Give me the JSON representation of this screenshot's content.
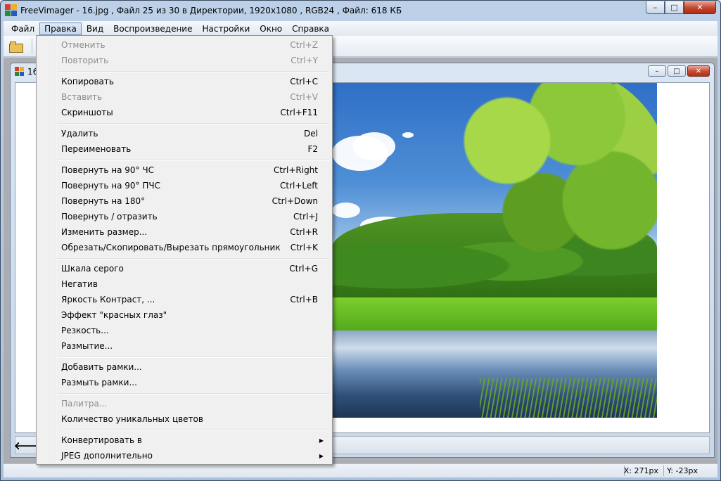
{
  "window": {
    "title": "FreeVimager - 16.jpg , Файл  25 из 30 в Директории, 1920x1080 , RGB24 , Файл: 618 КБ",
    "minimize": "–",
    "maximize": "□",
    "close": "✕"
  },
  "menubar": [
    "Файл",
    "Правка",
    "Вид",
    "Воспроизведение",
    "Настройки",
    "Окно",
    "Справка"
  ],
  "menubar_active": "Правка",
  "child": {
    "title": "16",
    "minimize": "–",
    "maximize": "□",
    "close": "✕",
    "back_glyph": "🡐"
  },
  "edit_menu": {
    "items": [
      {
        "label": "Отменить",
        "shortcut": "Ctrl+Z",
        "disabled": true
      },
      {
        "label": "Повторить",
        "shortcut": "Ctrl+Y",
        "disabled": true
      },
      {
        "label": "Копировать",
        "shortcut": "Ctrl+C",
        "disabled": false
      },
      {
        "label": "Вставить",
        "shortcut": "Ctrl+V",
        "disabled": true
      },
      {
        "label": "Скриншоты",
        "shortcut": "Ctrl+F11",
        "disabled": false
      },
      {
        "label": "Удалить",
        "shortcut": "Del",
        "disabled": false
      },
      {
        "label": "Переименовать",
        "shortcut": "F2",
        "disabled": false
      },
      {
        "label": "Повернуть на  90° ЧС",
        "shortcut": "Ctrl+Right",
        "disabled": false
      },
      {
        "label": "Повернуть на  90° ПЧС",
        "shortcut": "Ctrl+Left",
        "disabled": false
      },
      {
        "label": "Повернуть на 180°",
        "shortcut": "Ctrl+Down",
        "disabled": false
      },
      {
        "label": "Повернуть / отразить",
        "shortcut": "Ctrl+J",
        "disabled": false
      },
      {
        "label": "Изменить размер...",
        "shortcut": "Ctrl+R",
        "disabled": false
      },
      {
        "label": "Обрезать/Скопировать/Вырезать прямоугольник",
        "shortcut": "Ctrl+K",
        "disabled": false
      },
      {
        "label": "Шкала серого",
        "shortcut": "Ctrl+G",
        "disabled": false
      },
      {
        "label": "Негатив",
        "shortcut": "",
        "disabled": false
      },
      {
        "label": "Яркость Контраст, ...",
        "shortcut": "Ctrl+B",
        "disabled": false
      },
      {
        "label": "Эффект \"красных глаз\"",
        "shortcut": "",
        "disabled": false
      },
      {
        "label": "Резкость...",
        "shortcut": "",
        "disabled": false
      },
      {
        "label": "Размытие...",
        "shortcut": "",
        "disabled": false
      },
      {
        "label": "Добавить рамки...",
        "shortcut": "",
        "disabled": false
      },
      {
        "label": "Размыть рамки...",
        "shortcut": "",
        "disabled": false
      },
      {
        "label": "Палитра...",
        "shortcut": "",
        "disabled": true
      },
      {
        "label": "Количество уникальных цветов",
        "shortcut": "",
        "disabled": false
      },
      {
        "label": "Конвертировать в",
        "shortcut": "",
        "disabled": false,
        "submenu": true
      },
      {
        "label": "JPEG дополнительно",
        "shortcut": "",
        "disabled": false,
        "submenu": true
      }
    ],
    "submenu_arrow": "▶"
  },
  "statusbar": {
    "x": "X: 271px",
    "y": "Y: -23px"
  },
  "colors": {
    "menu_bg": "#f0f0f0",
    "disabled_text": "#8d8d8d",
    "close_button": "#c1432c"
  }
}
